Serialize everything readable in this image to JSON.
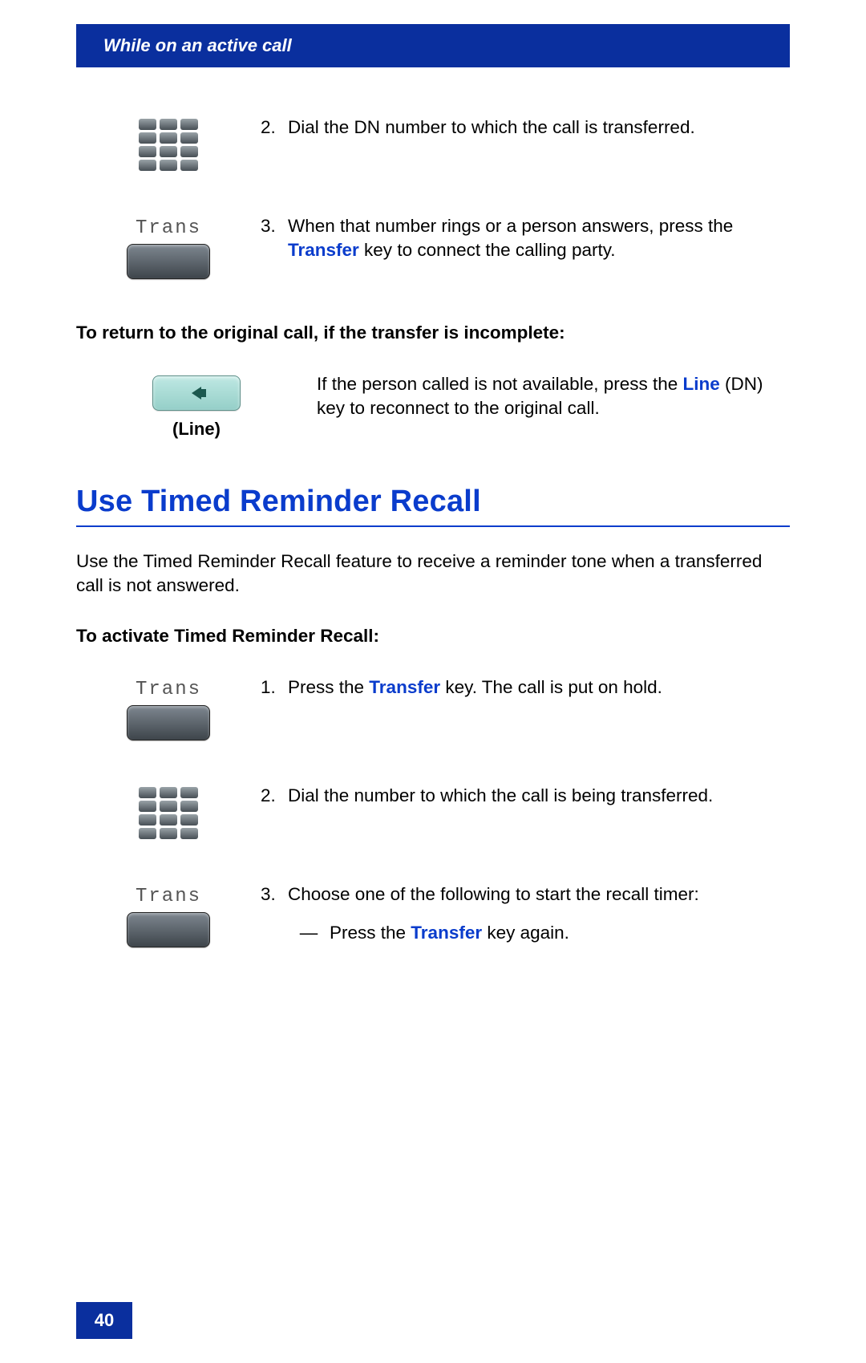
{
  "header": {
    "title": "While on an active call"
  },
  "steps_top": [
    {
      "icon": "keypad",
      "num": "2.",
      "text": "Dial the DN number to which the call is transferred."
    },
    {
      "icon": "trans",
      "icon_label": "Trans",
      "num": "3.",
      "prefix": "When that number rings or a person answers, press the ",
      "emph": "Transfer",
      "suffix": " key to connect the calling party."
    }
  ],
  "return_heading": "To return to the original call, if the transfer is incomplete:",
  "line_block": {
    "icon_caption": "(Line)",
    "prefix": "If the person called is not available, press the ",
    "emph": "Line",
    "suffix": " (DN) key to reconnect to the original call."
  },
  "section": {
    "title": "Use Timed Reminder Recall",
    "intro": "Use the Timed Reminder Recall feature to receive a reminder tone when a transferred call is not answered.",
    "activate_heading": "To activate Timed Reminder Recall:"
  },
  "steps_bottom": [
    {
      "icon": "trans",
      "icon_label": "Trans",
      "num": "1.",
      "prefix": "Press the ",
      "emph": "Transfer",
      "suffix": " key. The call is put on hold."
    },
    {
      "icon": "keypad",
      "num": "2.",
      "text": "Dial the number to which the call is being transferred."
    },
    {
      "icon": "trans",
      "icon_label": "Trans",
      "num": "3.",
      "text": "Choose one of the following to start the recall timer:",
      "sub_prefix": "Press the ",
      "sub_emph": "Transfer",
      "sub_suffix": " key again."
    }
  ],
  "page_number": "40"
}
